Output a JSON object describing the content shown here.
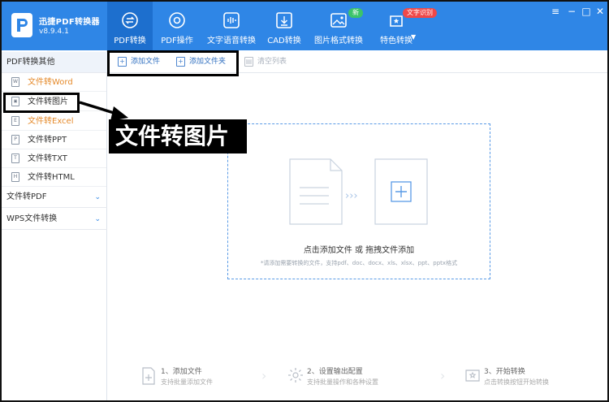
{
  "app": {
    "name": "迅捷PDF转换器",
    "version": "v8.9.4.1"
  },
  "nav": [
    {
      "label": "PDF转换",
      "icon": "swap-icon"
    },
    {
      "label": "PDF操作",
      "icon": "compass-icon"
    },
    {
      "label": "文字语音转换",
      "icon": "audio-wave-icon"
    },
    {
      "label": "CAD转换",
      "icon": "cad-download-icon"
    },
    {
      "label": "图片格式转换",
      "icon": "image-icon",
      "badge": "新"
    },
    {
      "label": "特色转换",
      "icon": "star-refresh-icon",
      "badge": "文字识别"
    }
  ],
  "sidebar": {
    "groups": [
      {
        "label": "PDF转换其他"
      },
      {
        "label": "文件转PDF"
      },
      {
        "label": "WPS文件转换"
      }
    ],
    "items": [
      {
        "label": "文件转Word",
        "icon": "W"
      },
      {
        "label": "文件转图片",
        "icon": "img"
      },
      {
        "label": "文件转Excel",
        "icon": "E"
      },
      {
        "label": "文件转PPT",
        "icon": "P"
      },
      {
        "label": "文件转TXT",
        "icon": "T"
      },
      {
        "label": "文件转HTML",
        "icon": "H"
      }
    ]
  },
  "actions": {
    "add_file": "添加文件",
    "add_folder": "添加文件夹",
    "clear_list": "清空列表"
  },
  "dropzone": {
    "title": "点击添加文件 或 拖拽文件添加",
    "subtitle": "*请添加需要转换的文件，支持pdf、doc、docx、xls、xlsx、ppt、pptx格式"
  },
  "steps": [
    {
      "title": "1、添加文件",
      "desc": "支持批量添加文件"
    },
    {
      "title": "2、设置输出配置",
      "desc": "支持批量操作和各种设置"
    },
    {
      "title": "3、开始转换",
      "desc": "点击转换按钮开始转换"
    }
  ],
  "annotation": {
    "callout": "文件转图片"
  },
  "colors": {
    "brand": "#2f86e6",
    "active_tab": "#1d6fce",
    "orange_text": "#e58a2b",
    "dropzone_border": "#5a9be6"
  }
}
